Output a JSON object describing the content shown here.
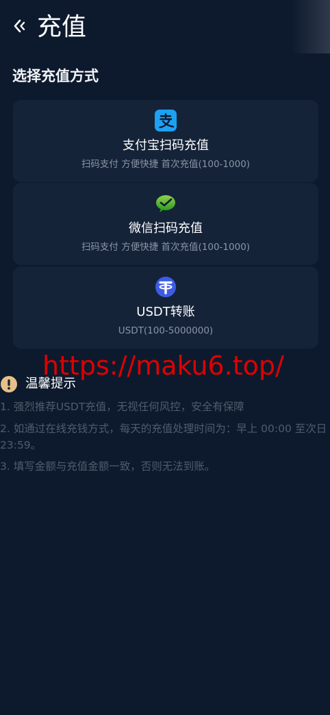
{
  "header": {
    "back_icon": "chevron-left-double-icon",
    "title": "充值"
  },
  "section": {
    "title": "选择充值方式"
  },
  "methods": [
    {
      "icon": "alipay-icon",
      "title": "支付宝扫码充值",
      "subtitle": "扫码支付 方便快捷 首次充值(100-1000)",
      "icon_color": "#1da1f2"
    },
    {
      "icon": "wechat-icon",
      "title": "微信扫码充值",
      "subtitle": "扫码支付 方便快捷 首次充值(100-1000)",
      "icon_color": "#4cb82b"
    },
    {
      "icon": "tether-usdt-icon",
      "title": "USDT转账",
      "subtitle": "USDT(100-5000000)",
      "icon_color": "#3d5ce6"
    }
  ],
  "watermark": {
    "text": "https://maku6.top/",
    "color": "#e00000"
  },
  "tips": {
    "icon": "exclamation-circle-icon",
    "title": "温馨提示",
    "items": [
      "1. 强烈推荐USDT充值，无视任何风控，安全有保障",
      "2. 如通过在线充钱方式，每天的充值处理时间为：早上 00:00 至次日 23:59。",
      "3. 填写金额与充值金额一致，否则无法到账。"
    ]
  },
  "colors": {
    "background": "#0d1a2d",
    "card": "#152338",
    "muted_text": "#8b96a6",
    "tip_text": "#4f5c6d"
  }
}
